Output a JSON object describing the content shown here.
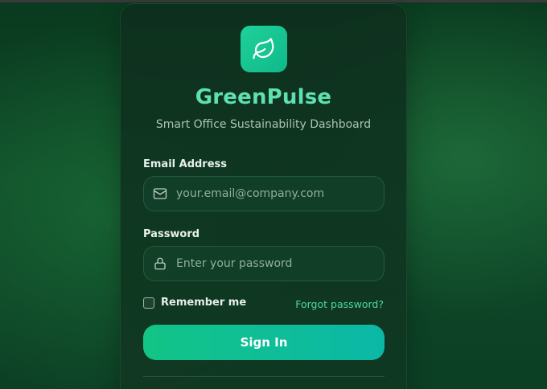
{
  "brand": {
    "name": "GreenPulse",
    "subtitle": "Smart Office Sustainability Dashboard",
    "logo_icon": "leaf-icon",
    "accent": "#1fd19a"
  },
  "form": {
    "email_label": "Email Address",
    "email_placeholder": "your.email@company.com",
    "email_icon": "mail-icon",
    "password_label": "Password",
    "password_placeholder": "Enter your password",
    "password_icon": "lock-icon",
    "remember_label": "Remember me",
    "remember_checked": false,
    "forgot_label": "Forgot password?",
    "submit_label": "Sign In"
  }
}
